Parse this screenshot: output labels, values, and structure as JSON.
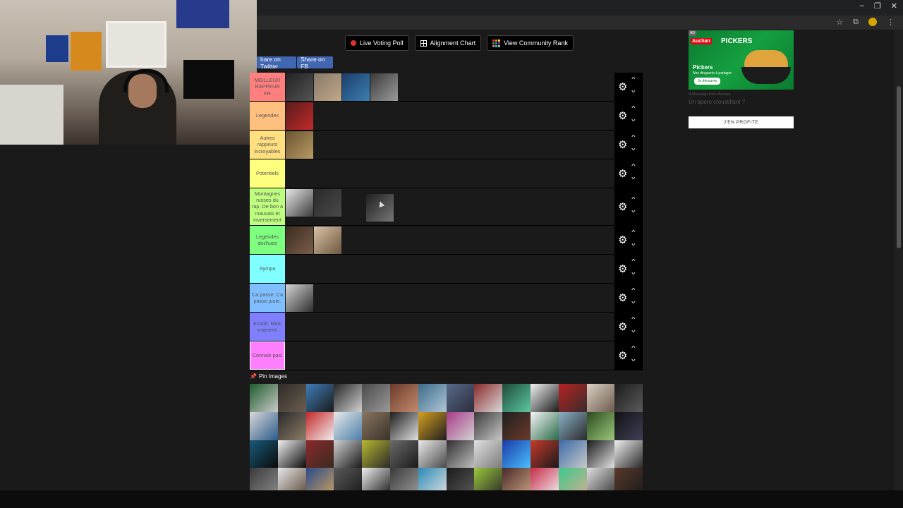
{
  "browser": {
    "window_controls": [
      "–",
      "❐",
      "✕"
    ],
    "toolbar_icons": [
      "star-icon",
      "extensions-icon",
      "profile-avatar",
      "menu-icon"
    ]
  },
  "toolbar": {
    "live_voting": "Live Voting Poll",
    "alignment": "Alignment Chart",
    "community": "View Community Rank"
  },
  "share": {
    "twitter": "hare on Twitter",
    "fb": "Share on FB"
  },
  "tiers": [
    {
      "label": "MEILLEUR RAPPEUR FR",
      "color": "#ff7f7f"
    },
    {
      "label": "Legendes",
      "color": "#ffbf7f"
    },
    {
      "label": "Autres rappeurs incroyables",
      "color": "#ffdf7f"
    },
    {
      "label": "Potentiels",
      "color": "#ffff7f"
    },
    {
      "label": "Montagnes russes du rap. De bon a mauvais et inversement",
      "color": "#bfff7f"
    },
    {
      "label": "Legendes dechues",
      "color": "#7fff7f"
    },
    {
      "label": "Sympa",
      "color": "#7fffff"
    },
    {
      "label": "Ca passe. Ca passe juste.",
      "color": "#7fbfff"
    },
    {
      "label": "Eclaté. Mais vraiment.",
      "color": "#7f7fff"
    },
    {
      "label": "Connais pas!",
      "color": "#ff7fff"
    }
  ],
  "pin": {
    "label": "Pin Images"
  },
  "ad": {
    "badge": "AD",
    "brand": "Auchan",
    "product": "PICKERS",
    "tagline": "Pickers",
    "subtext": "Nos dinguerie à partager",
    "button": "Je découvre",
    "message_from": "A Message from Auchan",
    "title": "Un apéro croustillant ?",
    "cta": "J'EN PROFITE"
  }
}
